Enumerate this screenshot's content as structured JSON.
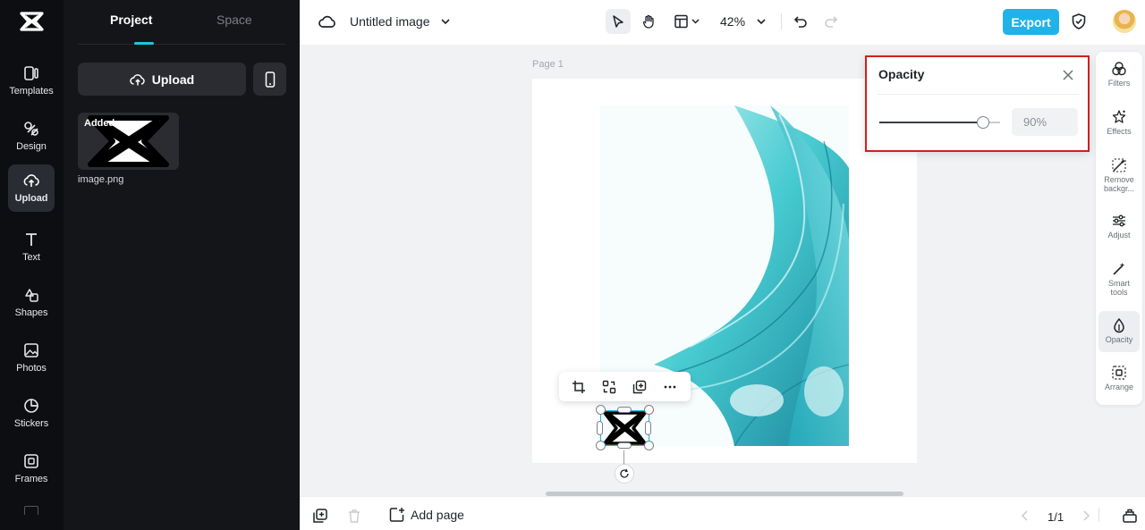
{
  "sidebar": {
    "items": [
      {
        "label": "Templates",
        "icon": "templates-icon"
      },
      {
        "label": "Design",
        "icon": "design-icon"
      },
      {
        "label": "Upload",
        "icon": "upload-cloud-icon"
      },
      {
        "label": "Text",
        "icon": "text-icon"
      },
      {
        "label": "Shapes",
        "icon": "shapes-icon"
      },
      {
        "label": "Photos",
        "icon": "photos-icon"
      },
      {
        "label": "Stickers",
        "icon": "stickers-icon"
      },
      {
        "label": "Frames",
        "icon": "frames-icon"
      }
    ],
    "active": "Upload"
  },
  "panel": {
    "tabs": [
      {
        "label": "Project"
      },
      {
        "label": "Space"
      }
    ],
    "active_tab": "Project",
    "upload_label": "Upload",
    "asset": {
      "badge": "Added",
      "filename": "image.png"
    }
  },
  "header": {
    "title": "Untitled image",
    "zoom": "42%",
    "export_label": "Export"
  },
  "canvas": {
    "page_label": "Page 1"
  },
  "right_tools": [
    {
      "label": "Filters",
      "icon": "filters-icon"
    },
    {
      "label": "Effects",
      "icon": "effects-icon"
    },
    {
      "label": "Remove backgr...",
      "icon": "remove-background-icon"
    },
    {
      "label": "Adjust",
      "icon": "adjust-icon"
    },
    {
      "label": "Smart tools",
      "icon": "smart-tools-icon"
    },
    {
      "label": "Opacity",
      "icon": "opacity-icon"
    },
    {
      "label": "Arrange",
      "icon": "arrange-icon"
    }
  ],
  "opacity_panel": {
    "title": "Opacity",
    "value": 0.9,
    "value_text": "90",
    "unit": "%"
  },
  "footer": {
    "add_page_label": "Add page",
    "page_count": "1/1"
  },
  "colors": {
    "accent": "#1fb3e8",
    "highlight_border": "#d0201f",
    "sidebar_bg": "#0d0e12",
    "panel_bg": "#141518"
  }
}
